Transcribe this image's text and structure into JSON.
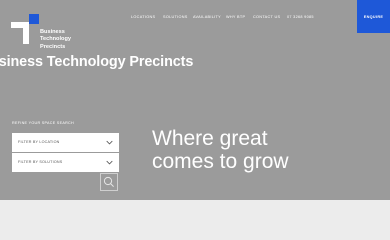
{
  "logo": {
    "line1": "Business",
    "line2": "Technology",
    "line3": "Precincts"
  },
  "nav": {
    "items": [
      "LOCATIONS",
      "SOLUTIONS",
      "AVAILABILITY",
      "WHY BTP",
      "CONTACT US",
      "07 3268 9085"
    ]
  },
  "cta": {
    "enquire": "ENQUIRE"
  },
  "hero": {
    "title": "usiness Technology Precincts",
    "tagline_line1": "Where great",
    "tagline_line2": "comes to grow"
  },
  "search": {
    "label": "REFINE YOUR SPACE SEARCH",
    "location": "FILTER BY LOCATION",
    "solutions": "FILTER BY SOLUTIONS"
  },
  "colors": {
    "hero_bg": "#9b9b9b",
    "accent": "#1e58d8",
    "text_light": "#ffffff"
  }
}
